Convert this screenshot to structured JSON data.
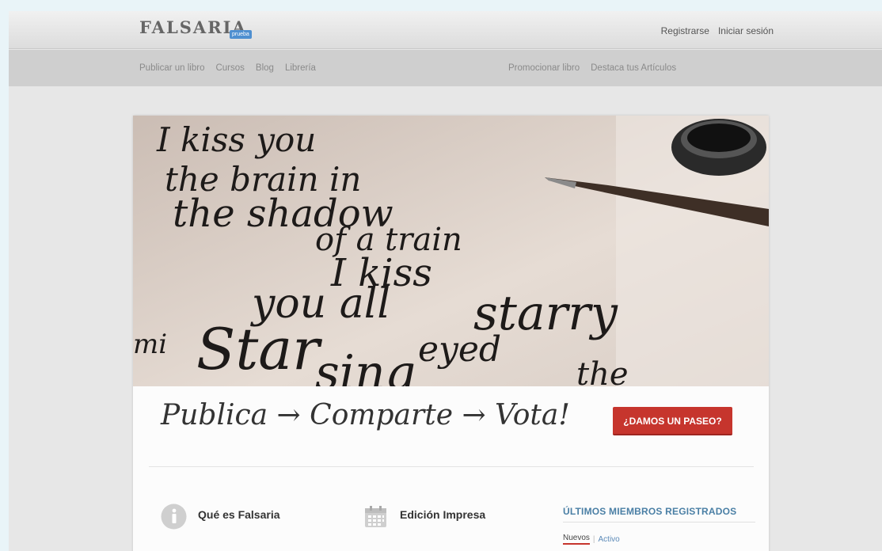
{
  "header": {
    "logo": "FALSARIA",
    "badge": "prueba",
    "register": "Registrarse",
    "login": "Iniciar sesión"
  },
  "nav": {
    "left": [
      "Publicar un libro",
      "Cursos",
      "Blog",
      "Librería"
    ],
    "right": [
      "Promocionar libro",
      "Destaca tus Artículos"
    ]
  },
  "hero": {
    "image": "calligraphy-pen-ink"
  },
  "main": {
    "tagline": "Publica → Comparte → Vota!",
    "cta": "¿DAMOS UN PASEO?"
  },
  "features": [
    {
      "icon": "info-icon",
      "title": "Qué es Falsaria"
    },
    {
      "icon": "calendar-icon",
      "title": "Edición Impresa"
    }
  ],
  "members": {
    "heading": "ÚLTIMOS MIEMBROS REGISTRADOS",
    "tabs": [
      "Nuevos",
      "Activo"
    ]
  },
  "colors": {
    "accent": "#c6352d",
    "link": "#4a7fa5",
    "badge": "#4e8fd0"
  }
}
